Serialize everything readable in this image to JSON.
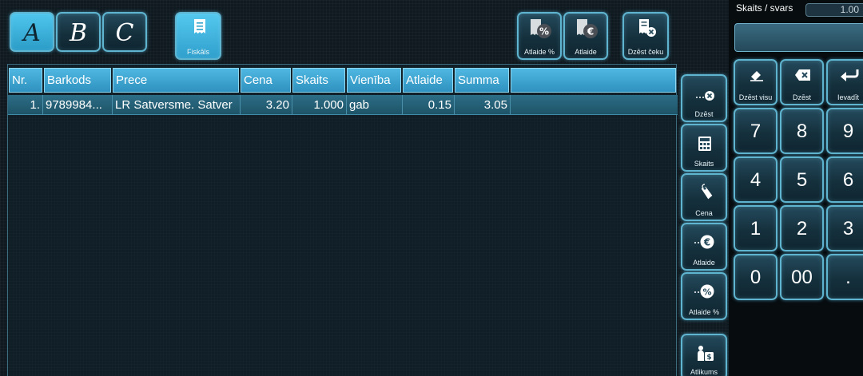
{
  "tabs": [
    {
      "label": "A",
      "active": true
    },
    {
      "label": "B",
      "active": false
    },
    {
      "label": "C",
      "active": false
    }
  ],
  "toolbar": {
    "fiscal_label": "Fiskāls",
    "discount_pct_label": "Atlaide %",
    "discount_label": "Atlaide",
    "delete_receipt_label": "Dzēst čeku"
  },
  "table": {
    "columns": [
      "Nr.",
      "Barkods",
      "Prece",
      "Cena",
      "Skaits",
      "Vienība",
      "Atlaide",
      "Summa"
    ],
    "rows": [
      {
        "nr": "1.",
        "barcode": "9789984...",
        "item": "LR Satversme. Satver",
        "price": "3.20",
        "qty": "1.000",
        "unit": "gab",
        "discount": "0.15",
        "sum": "3.05"
      }
    ]
  },
  "side_buttons": {
    "delete": "Dzēst",
    "quantity": "Skaits",
    "price": "Cena",
    "discount": "Atlaide",
    "discount_pct": "Atlaide %",
    "change": "Atlikums"
  },
  "keypad": {
    "header_label": "Skaits / svars",
    "header_value": "1.00",
    "input_value": "",
    "clear_all": "Dzēst visu",
    "clear": "Dzēst",
    "enter": "Ievadīt",
    "keys": [
      "7",
      "8",
      "9",
      "4",
      "5",
      "6",
      "1",
      "2",
      "3",
      "0",
      "00",
      "."
    ]
  },
  "colors": {
    "accent": "#4fc6ee",
    "border": "#5fb4cf",
    "background": "#0f1a20"
  }
}
